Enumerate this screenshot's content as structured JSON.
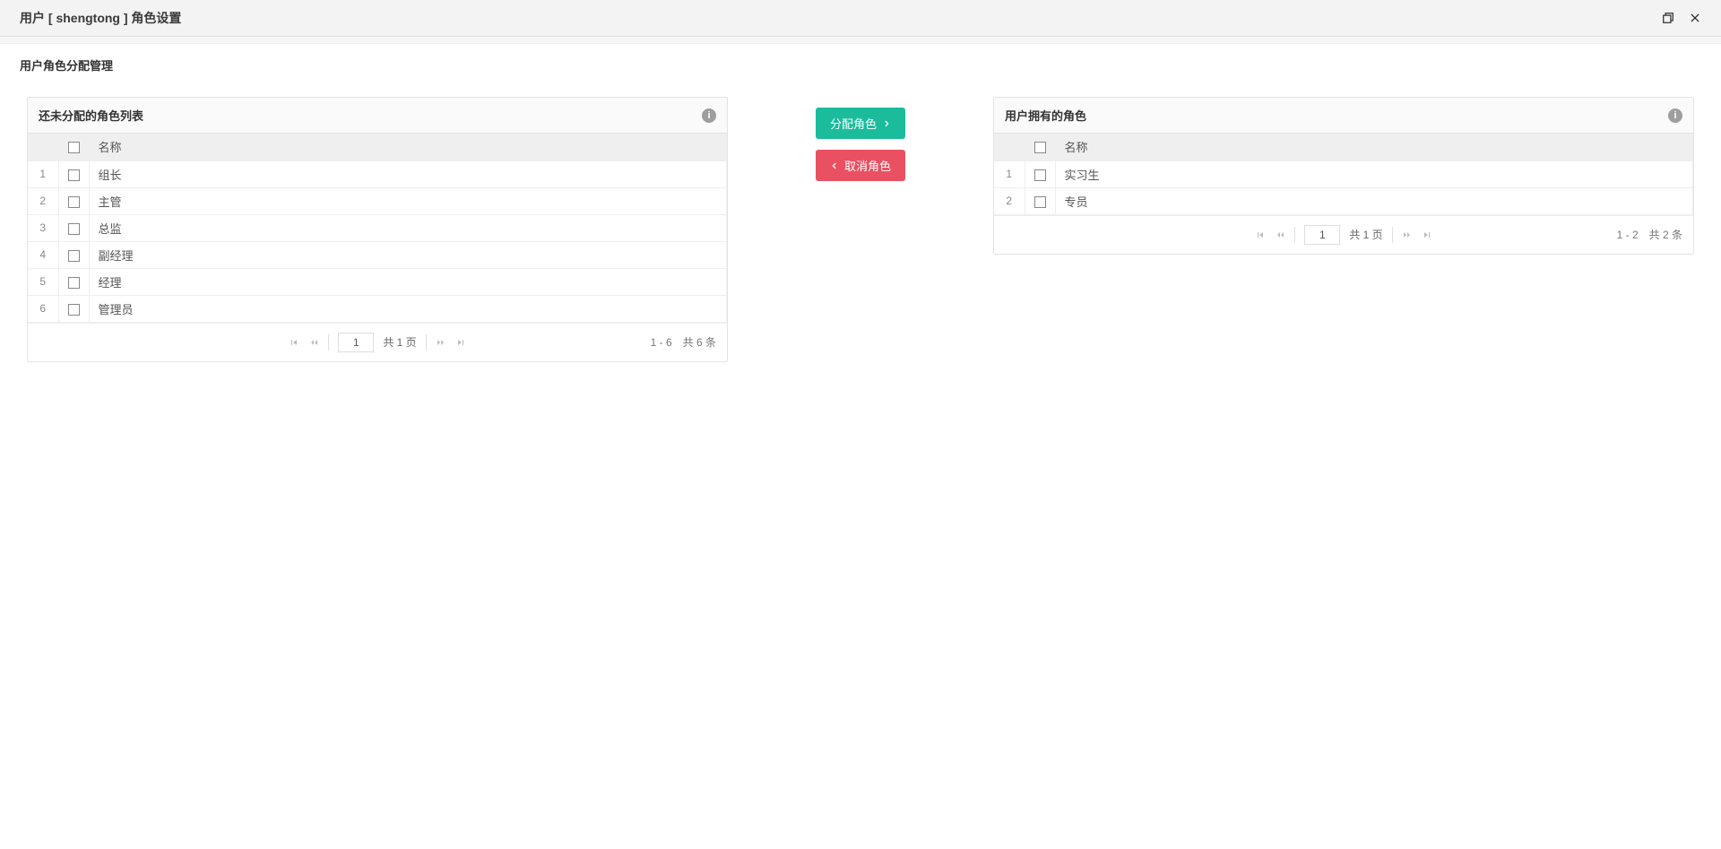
{
  "topbar": {
    "title": "用户 [ shengtong ] 角色设置"
  },
  "section": {
    "title": "用户角色分配管理"
  },
  "available_panel": {
    "title": "还未分配的角色列表",
    "col_name": "名称",
    "rows": [
      {
        "idx": "1",
        "name": "组长"
      },
      {
        "idx": "2",
        "name": "主管"
      },
      {
        "idx": "3",
        "name": "总监"
      },
      {
        "idx": "4",
        "name": "副经理"
      },
      {
        "idx": "5",
        "name": "经理"
      },
      {
        "idx": "6",
        "name": "管理员"
      }
    ],
    "pager": {
      "page": "1",
      "total_pages_label": "共 1 页",
      "stats": "1 - 6　共 6 条"
    }
  },
  "assigned_panel": {
    "title": "用户拥有的角色",
    "col_name": "名称",
    "rows": [
      {
        "idx": "1",
        "name": "实习生"
      },
      {
        "idx": "2",
        "name": "专员"
      }
    ],
    "pager": {
      "page": "1",
      "total_pages_label": "共 1 页",
      "stats": "1 - 2　共 2 条"
    }
  },
  "actions": {
    "assign_label": "分配角色",
    "revoke_label": "取消角色"
  },
  "colors": {
    "green": "#1abc9c",
    "red": "#e95062"
  }
}
